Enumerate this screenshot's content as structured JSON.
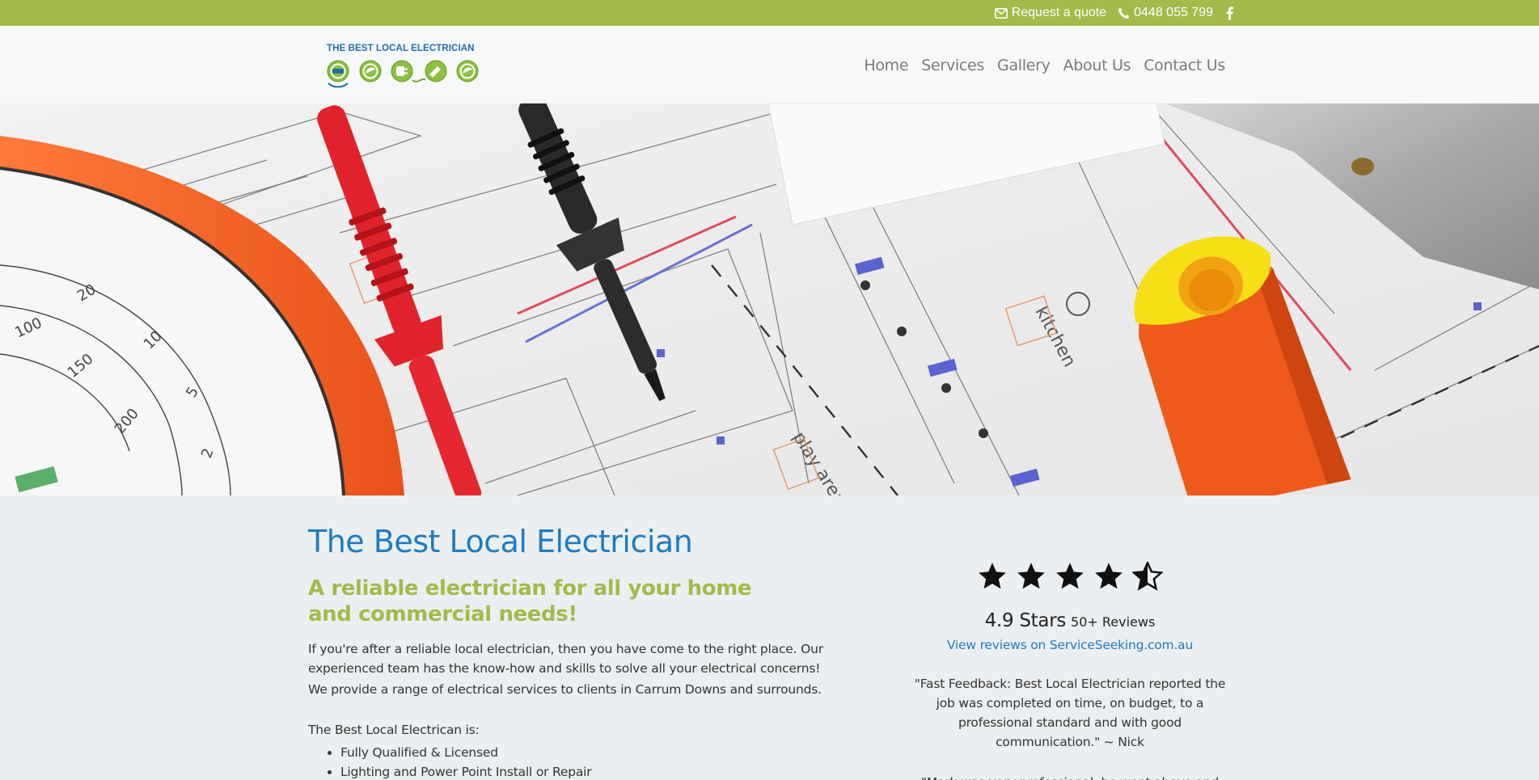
{
  "topbar": {
    "quote_label": "Request a quote",
    "phone": "0448 055 799"
  },
  "brand": {
    "name": "THE BEST LOCAL ELECTRICIAN",
    "primary_color": "#1f7bc1",
    "accent_color": "#a2bb4a"
  },
  "nav": {
    "items": [
      "Home",
      "Services",
      "Gallery",
      "About Us",
      "Contact Us"
    ]
  },
  "intro": {
    "title": "The Best Local Electrician",
    "subtitle": "A reliable electrician for all your home and commercial needs!",
    "paragraph1": "If you're after a reliable local electrician, then you have come to the right place. Our experienced team has the know-how and skills to solve all your electrical concerns!",
    "paragraph2": "We provide a range of electrical services to clients in Carrum Downs and surrounds.",
    "list_label": "The Best Local Electrican is:",
    "features": [
      "Fully Qualified & Licensed",
      "Lighting and Power Point Install or Repair"
    ]
  },
  "reviews": {
    "stars": 4.5,
    "rating_text": "4.9 Stars",
    "count_text": "50+ Reviews",
    "link_text": "View reviews on ServiceSeeking.com.au",
    "quote1": "\"Fast Feedback: Best Local Electrician reported the job was completed on time, on budget, to a professional standard and with good communication.\" ~ Nick",
    "quote2": "\"Mark was very professional, he went above and"
  },
  "icons": [
    "envelope-icon",
    "phone-icon",
    "facebook-icon",
    "star-icon",
    "star-half-icon"
  ]
}
